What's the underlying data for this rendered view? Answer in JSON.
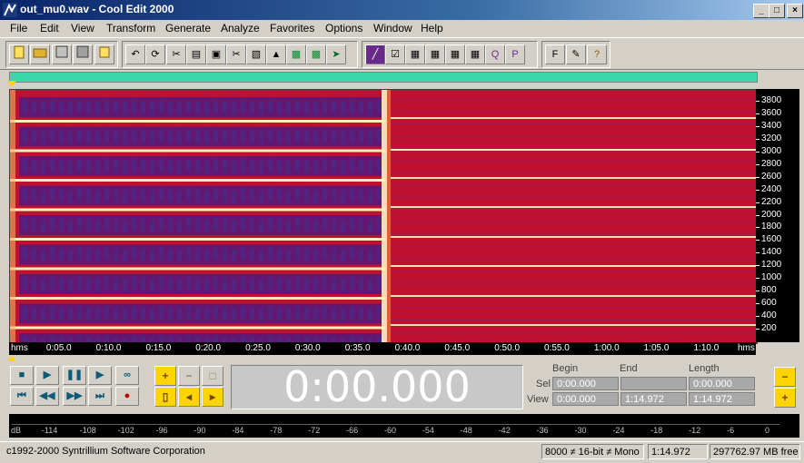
{
  "window": {
    "title": "out_mu0.wav - Cool Edit 2000",
    "controls": [
      "minimize",
      "maximize",
      "close"
    ]
  },
  "menu": [
    "File",
    "Edit",
    "View",
    "Transform",
    "Generate",
    "Analyze",
    "Favorites",
    "Options",
    "Window",
    "Help"
  ],
  "toolbar": {
    "group1": [
      "new-file-icon",
      "open-folder-icon",
      "save-icon",
      "save-as-icon",
      "close-file-icon"
    ],
    "group2": [
      "undo-icon",
      "repeat-icon",
      "cut-icon",
      "copy-icon",
      "paste-icon",
      "mix-paste-icon",
      "trim-icon",
      "insert-icon",
      "generate-icon",
      "analyze-icon",
      "spectral-icon",
      "scripts-icon"
    ],
    "group3": [
      "waveform-view-icon",
      "select-icon",
      "grid-icon-1",
      "grid-icon-2",
      "grid-icon-3",
      "grid-icon-4",
      "zoom-q-icon",
      "preview-p-icon",
      "cd-icon"
    ],
    "group4_labels": [
      "F",
      "✎",
      "?"
    ]
  },
  "spectrogram": {
    "freq_ticks": [
      "3800",
      "3600",
      "3400",
      "3200",
      "3000",
      "2800",
      "2600",
      "2400",
      "2200",
      "2000",
      "1800",
      "1600",
      "1400",
      "1200",
      "1000",
      "800",
      "600",
      "400",
      "200"
    ],
    "colors": {
      "background": "#c01030",
      "purple": "#5a1878",
      "hot": "#fff2c0",
      "line": "#ffffc0"
    }
  },
  "time_ruler": {
    "ticks": [
      "hms",
      "0:05.0",
      "0:10.0",
      "0:15.0",
      "0:20.0",
      "0:25.0",
      "0:30.0",
      "0:35.0",
      "0:40.0",
      "0:45.0",
      "0:50.0",
      "0:55.0",
      "1:00.0",
      "1:05.0",
      "1:10.0",
      "hms"
    ]
  },
  "transport": {
    "row1": [
      "■",
      "▶",
      "❚❚",
      "▶",
      "∞"
    ],
    "row2": [
      "⏮",
      "◀◀",
      "▶▶",
      "⏭",
      "●"
    ],
    "icons1": [
      "stop-icon",
      "play-icon",
      "pause-icon",
      "play-to-end-icon",
      "loop-icon"
    ],
    "icons2": [
      "go-to-start-icon",
      "rewind-icon",
      "fast-forward-icon",
      "go-to-end-icon",
      "record-icon"
    ]
  },
  "zoom": {
    "row1": [
      "+",
      "−",
      "□"
    ],
    "row2": [
      "▯",
      "◂",
      "▸"
    ],
    "side": [
      "−",
      "+"
    ]
  },
  "time_display": "0:00.000",
  "selection": {
    "headers": [
      "Begin",
      "End",
      "Length"
    ],
    "sel_label": "Sel",
    "view_label": "View",
    "sel": [
      "0:00.000",
      "",
      "0:00.000"
    ],
    "view": [
      "0:00.000",
      "1:14.972",
      "1:14.972"
    ]
  },
  "meter": {
    "ticks": [
      "dB",
      "-114",
      "-108",
      "-102",
      "-96",
      "-90",
      "-84",
      "-78",
      "-72",
      "-66",
      "-60",
      "-54",
      "-48",
      "-42",
      "-36",
      "-30",
      "-24",
      "-18",
      "-12",
      "-6",
      "0"
    ]
  },
  "status": {
    "copyright": "c1992-2000 Syntrillium Software Corporation",
    "format": "8000 ≠ 16-bit ≠ Mono",
    "duration": "1:14.972",
    "free": "297762.97 MB free"
  }
}
